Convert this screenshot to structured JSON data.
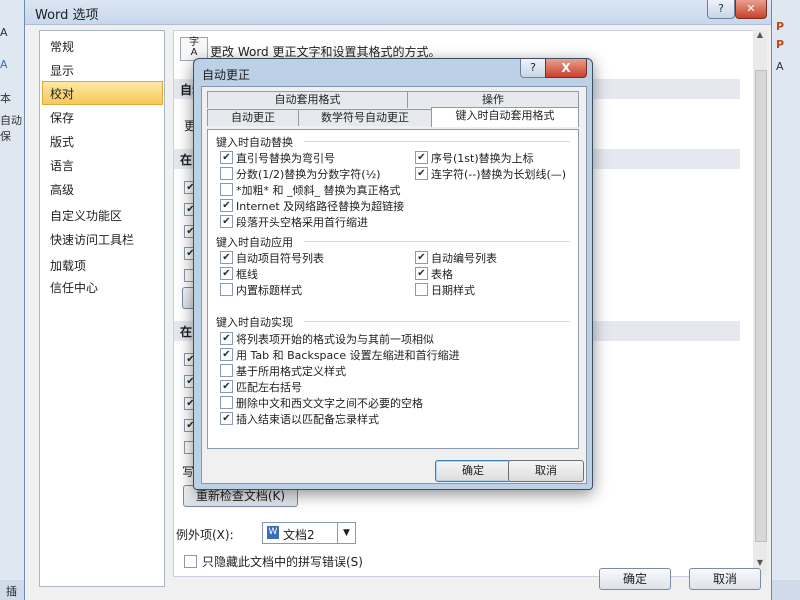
{
  "word_options": {
    "title": "Word 选项",
    "help": "?",
    "nav": [
      "常规",
      "显示",
      "校对",
      "保存",
      "版式",
      "语言",
      "高级",
      "自定义功能区",
      "快速访问工具栏",
      "加载项",
      "信任中心"
    ],
    "selected_nav": "校对",
    "header_text": "更改 Word 更正文字和设置其格式的方式。",
    "section_autocorrect": "自动",
    "change_text": "更改",
    "section_m": "在 M",
    "section_w": "在 W",
    "write_text": "写",
    "recheck_button": "重新检查文档(K)",
    "exceptions_label": "例外项(X):",
    "exceptions_value": "文档2",
    "hide_errors": "只隐藏此文档中的拼写错误(S)",
    "ok": "确定",
    "cancel": "取消"
  },
  "dialog": {
    "title": "自动更正",
    "help": "?",
    "close": "X",
    "tabs_top": [
      "自动套用格式",
      "操作"
    ],
    "tabs_bottom": [
      "自动更正",
      "数学符号自动更正",
      "键入时自动套用格式"
    ],
    "active_tab": "键入时自动套用格式",
    "group1": "键入时自动替换",
    "group1_left": [
      {
        "label": "直引号替换为弯引号",
        "checked": true
      },
      {
        "label": "分数(1/2)替换为分数字符(½)",
        "checked": false
      },
      {
        "label": "*加粗* 和 _倾斜_ 替换为真正格式",
        "checked": false
      },
      {
        "label": "Internet 及网络路径替换为超链接",
        "checked": true
      },
      {
        "label": "段落开头空格采用首行缩进",
        "checked": true
      }
    ],
    "group1_right": [
      {
        "label": "序号(1st)替换为上标",
        "checked": true
      },
      {
        "label": "连字符(--)替换为长划线(—)",
        "checked": true
      }
    ],
    "group2": "键入时自动应用",
    "group2_left": [
      {
        "label": "自动项目符号列表",
        "checked": true
      },
      {
        "label": "框线",
        "checked": true
      },
      {
        "label": "内置标题样式",
        "checked": false
      }
    ],
    "group2_right": [
      {
        "label": "自动编号列表",
        "checked": true
      },
      {
        "label": "表格",
        "checked": true
      },
      {
        "label": "日期样式",
        "checked": false
      }
    ],
    "group3": "键入时自动实现",
    "group3_items": [
      {
        "label": "将列表项开始的格式设为与其前一项相似",
        "checked": true
      },
      {
        "label": "用 Tab 和 Backspace 设置左缩进和首行缩进",
        "checked": true
      },
      {
        "label": "基于所用格式定义样式",
        "checked": false
      },
      {
        "label": "匹配左右括号",
        "checked": true
      },
      {
        "label": "删除中文和西文文字之间不必要的空格",
        "checked": false
      },
      {
        "label": "插入结束语以匹配备忘录样式",
        "checked": true
      }
    ],
    "ok": "确定",
    "cancel": "取消"
  },
  "background": {
    "left_glyphs": [
      "A",
      "A",
      "本",
      "自动保"
    ],
    "right_glyphs": [
      "P",
      "P",
      "A"
    ],
    "bottom_left": "插"
  }
}
